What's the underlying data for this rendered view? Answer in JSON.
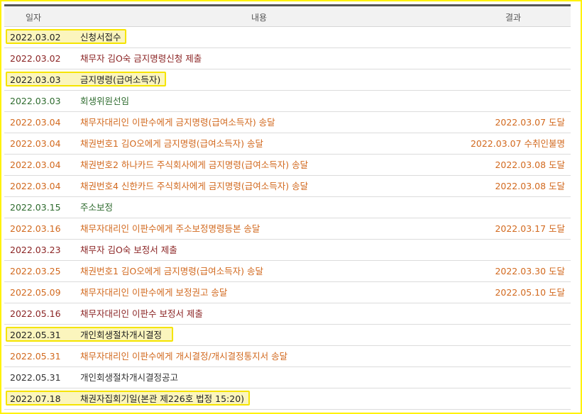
{
  "colors": {
    "black": "#333333",
    "maroon": "#8b2424",
    "green": "#2e6b2e",
    "orange": "#d2691e",
    "highlight_border": "#f5e400",
    "highlight_fill": "#fbf5bd"
  },
  "table": {
    "headers": {
      "date": "일자",
      "content": "내용",
      "result": "결과"
    },
    "rows": [
      {
        "date": "2022.03.02",
        "content": "신청서접수",
        "result": "",
        "color": "black",
        "highlight": true
      },
      {
        "date": "2022.03.02",
        "content": "채무자 김O숙 금지명령신청 제출",
        "result": "",
        "color": "maroon",
        "highlight": false
      },
      {
        "date": "2022.03.03",
        "content": "금지명령(급여소득자)",
        "result": "",
        "color": "green",
        "highlight": true
      },
      {
        "date": "2022.03.03",
        "content": "회생위원선임",
        "result": "",
        "color": "green",
        "highlight": false
      },
      {
        "date": "2022.03.04",
        "content": "채무자대리인 이판수에게 금지명령(급여소득자) 송달",
        "result": "2022.03.07 도달",
        "color": "orange",
        "highlight": false
      },
      {
        "date": "2022.03.04",
        "content": "채권번호1 김O오에게 금지명령(급여소득자) 송달",
        "result": "2022.03.07 수취인불명",
        "color": "orange",
        "highlight": false
      },
      {
        "date": "2022.03.04",
        "content": "채권번호2 하나카드 주식회사에게 금지명령(급여소득자) 송달",
        "result": "2022.03.08 도달",
        "color": "orange",
        "highlight": false
      },
      {
        "date": "2022.03.04",
        "content": "채권번호4 신한카드 주식회사에게 금지명령(급여소득자) 송달",
        "result": "2022.03.08 도달",
        "color": "orange",
        "highlight": false
      },
      {
        "date": "2022.03.15",
        "content": "주소보정",
        "result": "",
        "color": "green",
        "highlight": false
      },
      {
        "date": "2022.03.16",
        "content": "채무자대리인 이판수에게 주소보정명령등본 송달",
        "result": "2022.03.17 도달",
        "color": "orange",
        "highlight": false
      },
      {
        "date": "2022.03.23",
        "content": "채무자 김O숙 보정서 제출",
        "result": "",
        "color": "maroon",
        "highlight": false
      },
      {
        "date": "2022.03.25",
        "content": "채권번호1 김O오에게 금지명령(급여소득자) 송달",
        "result": "2022.03.30 도달",
        "color": "orange",
        "highlight": false
      },
      {
        "date": "2022.05.09",
        "content": "채무자대리인 이판수에게 보정권고 송달",
        "result": "2022.05.10 도달",
        "color": "orange",
        "highlight": false
      },
      {
        "date": "2022.05.16",
        "content": "채무자대리인 이판수 보정서 제출",
        "result": "",
        "color": "maroon",
        "highlight": false
      },
      {
        "date": "2022.05.31",
        "content": "개인회생절차개시결정",
        "result": "",
        "color": "black",
        "highlight": true
      },
      {
        "date": "2022.05.31",
        "content": "채무자대리인 이판수에게 개시결정/개시결정통지서 송달",
        "result": "",
        "color": "orange",
        "highlight": false
      },
      {
        "date": "2022.05.31",
        "content": "개인회생절차개시결정공고",
        "result": "",
        "color": "black",
        "highlight": false
      },
      {
        "date": "2022.07.18",
        "content": "채권자집회기일(본관 제226호 법정 15:20)",
        "result": "",
        "color": "black",
        "highlight": true
      }
    ]
  }
}
